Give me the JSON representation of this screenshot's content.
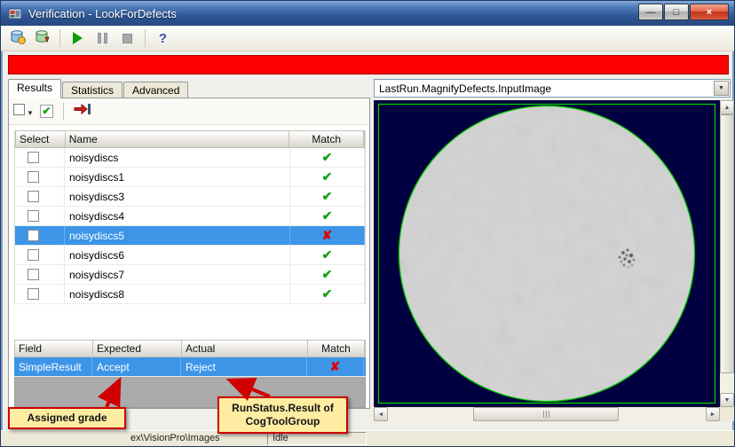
{
  "window": {
    "title": "Verification - LookForDefects"
  },
  "icons": {
    "minimize": "—",
    "maximize": "□",
    "close": "×",
    "help": "?",
    "dropdown_arrow": "▼",
    "select_dropdown_arrow": "▼",
    "scroll_up": "▲",
    "scroll_down": "▼",
    "scroll_left": "◄",
    "scroll_right": "►",
    "pass": "✔",
    "fail": "✘"
  },
  "tabs": {
    "items": [
      {
        "label": "Results",
        "active": true
      },
      {
        "label": "Statistics",
        "active": false
      },
      {
        "label": "Advanced",
        "active": false
      }
    ]
  },
  "results_table": {
    "headers": [
      "Select",
      "Name",
      "Match"
    ],
    "rows": [
      {
        "name": "noisydiscs",
        "checked": false,
        "match": "pass",
        "selected": false
      },
      {
        "name": "noisydiscs1",
        "checked": false,
        "match": "pass",
        "selected": false
      },
      {
        "name": "noisydiscs3",
        "checked": false,
        "match": "pass",
        "selected": false
      },
      {
        "name": "noisydiscs4",
        "checked": false,
        "match": "pass",
        "selected": false
      },
      {
        "name": "noisydiscs5",
        "checked": false,
        "match": "fail",
        "selected": true
      },
      {
        "name": "noisydiscs6",
        "checked": false,
        "match": "pass",
        "selected": false
      },
      {
        "name": "noisydiscs7",
        "checked": false,
        "match": "pass",
        "selected": false
      },
      {
        "name": "noisydiscs8",
        "checked": false,
        "match": "pass",
        "selected": false
      }
    ]
  },
  "detail_table": {
    "headers": [
      "Field",
      "Expected",
      "Actual",
      "Match"
    ],
    "rows": [
      {
        "field": "SimpleResult",
        "expected": "Accept",
        "actual": "Reject",
        "match": "fail",
        "selected": true
      }
    ]
  },
  "callouts": {
    "assigned_grade": "Assigned grade",
    "runstatus": "RunStatus.Result of\nCogToolGroup"
  },
  "image_panel": {
    "selected_image": "LastRun.MagnifyDefects.InputImage"
  },
  "statusbar": {
    "path_text": "ex\\VisionPro\\Images",
    "state": "Idle"
  },
  "colors": {
    "selection": "#3d95e8",
    "alert_bar": "#ff0000",
    "pass": "#16a016",
    "fail": "#e00000",
    "callout_bg": "#fdeca1",
    "callout_border": "#d00000",
    "image_background": "#000040",
    "overlay_green": "#00cc00"
  }
}
